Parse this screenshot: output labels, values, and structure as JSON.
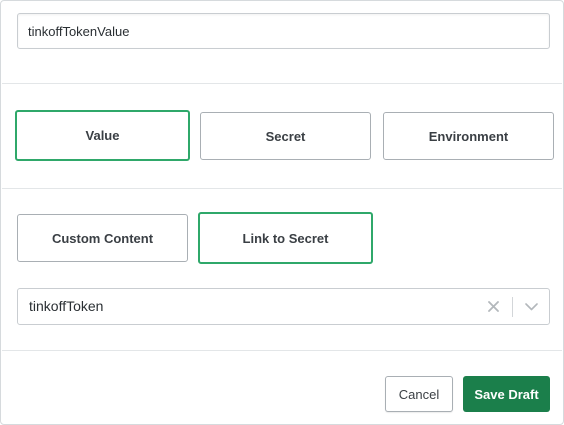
{
  "name_field": {
    "value": "tinkoffTokenValue"
  },
  "source_types": [
    {
      "label": "Value",
      "selected": true
    },
    {
      "label": "Secret",
      "selected": false
    },
    {
      "label": "Environment",
      "selected": false
    }
  ],
  "content_modes": [
    {
      "label": "Custom Content",
      "selected": false
    },
    {
      "label": "Link to Secret",
      "selected": true
    }
  ],
  "secret_select": {
    "value": "tinkoffToken",
    "clear_icon": "close-icon",
    "dropdown_icon": "chevron-down-icon"
  },
  "footer": {
    "cancel_label": "Cancel",
    "save_label": "Save Draft"
  },
  "colors": {
    "selected_border": "#2fa86a",
    "primary_button": "#1b7f4b"
  }
}
